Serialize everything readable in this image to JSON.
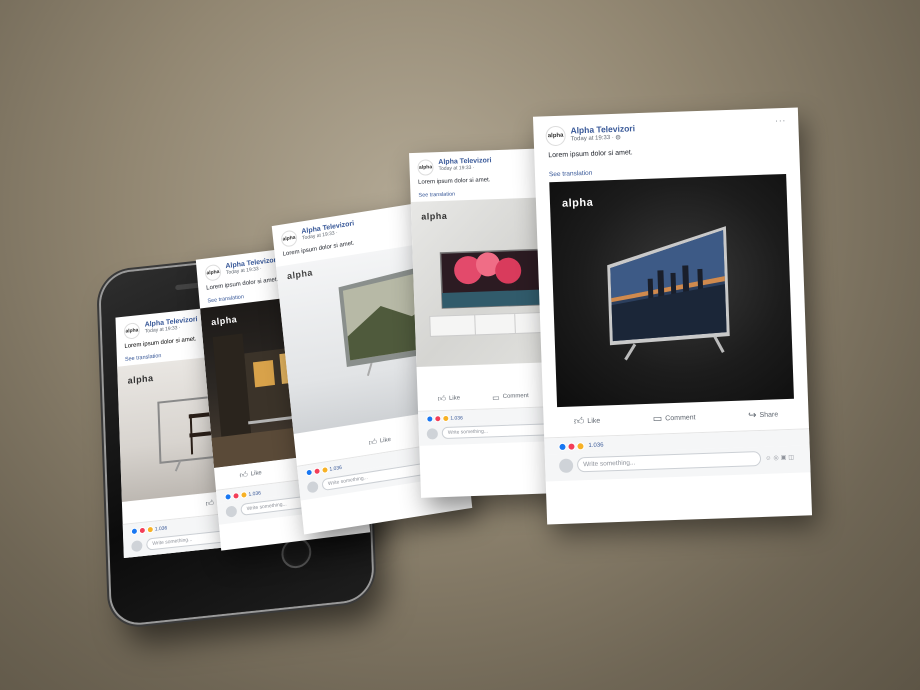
{
  "post": {
    "page_name": "Alpha Televizori",
    "avatar_text": "alpha",
    "timestamp": "Today at 19:33 · ",
    "text": "Lorem ipsum dolor si amet.",
    "see_translation": "See translation",
    "brand_logo": "alpha",
    "actions": {
      "like": "Like",
      "comment": "Comment",
      "share": "Share"
    },
    "reaction_count": "1.036",
    "comment_placeholder": "Write something...",
    "more_menu": "···"
  },
  "icons": {
    "like": "thumbs-up-icon",
    "comment": "comment-icon",
    "share": "share-icon",
    "globe": "globe-icon",
    "comment_tools": "emoji-camera-gif-sticker-icons"
  },
  "colors": {
    "facebook_blue": "#385898",
    "background": "#928772"
  }
}
